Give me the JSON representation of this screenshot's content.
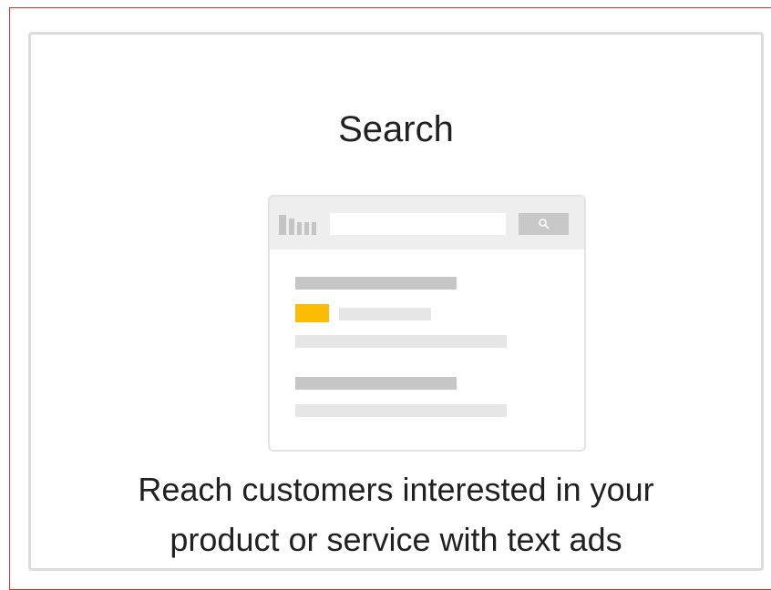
{
  "card": {
    "title": "Search",
    "description_line1": "Reach customers interested in your",
    "description_line2": "product or service with text ads",
    "illustration_icon": "search-results-page-icon"
  },
  "colors": {
    "frame_border": "#d93025",
    "card_border": "#dcdcdc",
    "ad_highlight": "#fbbc04",
    "text": "#212121"
  }
}
